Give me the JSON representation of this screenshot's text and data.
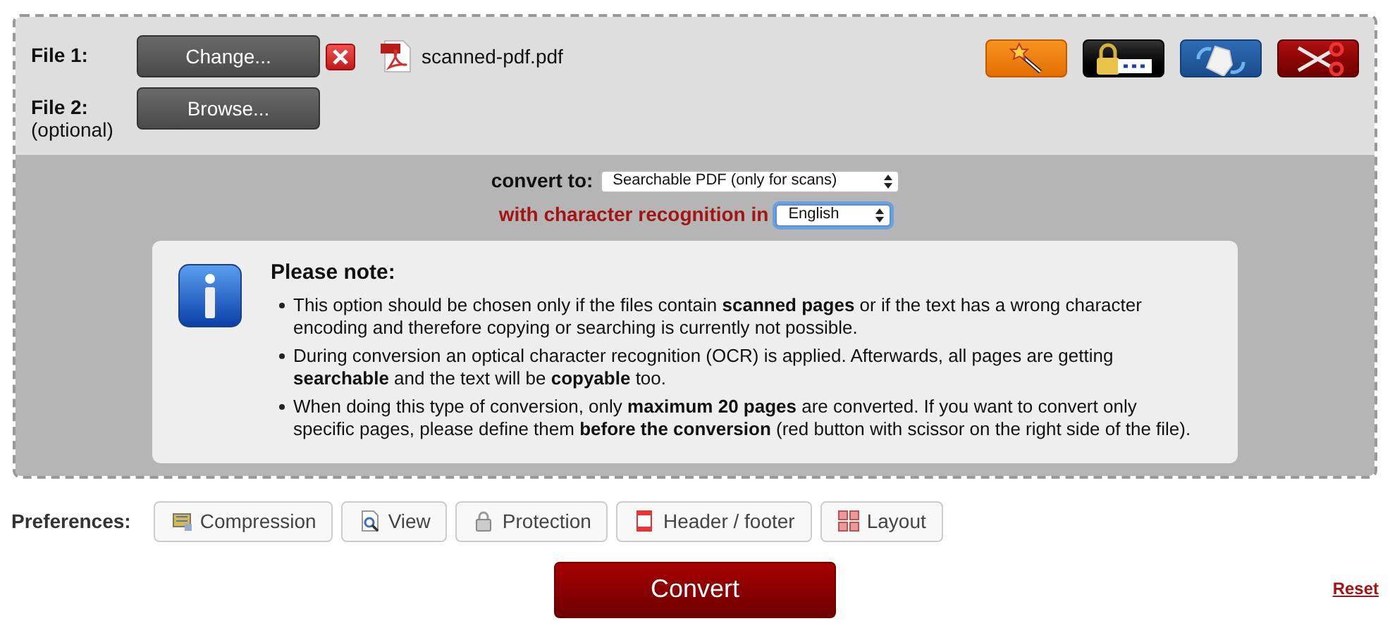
{
  "files": [
    {
      "label": "File 1:",
      "button": "Change...",
      "remove": true,
      "file_name": "scanned-pdf.pdf"
    },
    {
      "label": "File 2:",
      "sublabel": "(optional)",
      "button": "Browse...",
      "remove": false
    }
  ],
  "tools": [
    {
      "kind": "wand"
    },
    {
      "kind": "lock"
    },
    {
      "kind": "rotate"
    },
    {
      "kind": "scissors"
    }
  ],
  "convert_to": {
    "label": "convert to:",
    "value": "Searchable PDF (only for scans)"
  },
  "ocr": {
    "label": "with character recognition in",
    "value": "English"
  },
  "note": {
    "title": "Please note:",
    "items": [
      "This option should be chosen only if the files contain **scanned pages** or if the text has a wrong character encoding and therefore copying or searching is currently not possible.",
      "During conversion an optical character recognition (OCR) is applied. Afterwards, all pages are getting **searchable** and the text will be **copyable** too.",
      "When doing this type of conversion, only **maximum 20 pages** are converted. If you want to convert only specific pages, please define them **before the conversion** (red button with scissor on the right side of the file)."
    ]
  },
  "preferences": {
    "label": "Preferences:",
    "buttons": [
      {
        "kind": "compression",
        "label": "Compression"
      },
      {
        "kind": "view",
        "label": "View"
      },
      {
        "kind": "protection",
        "label": "Protection"
      },
      {
        "kind": "header",
        "label": "Header / footer"
      },
      {
        "kind": "layout",
        "label": "Layout"
      }
    ]
  },
  "convert_button": "Convert",
  "reset_link": "Reset"
}
